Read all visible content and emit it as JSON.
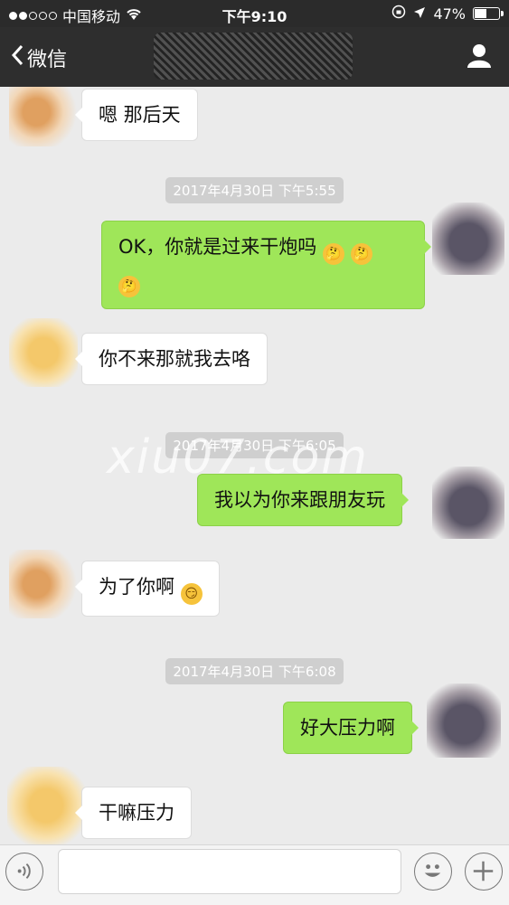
{
  "status_bar": {
    "carrier": "中国移动",
    "time": "下午9:10",
    "battery": "47%",
    "battery_level": 0.47
  },
  "nav": {
    "back_label": "微信"
  },
  "messages": [
    {
      "side": "left",
      "text": "嗯  那后天"
    },
    {
      "timestamp": "2017年4月30日 下午5:55"
    },
    {
      "side": "right",
      "text": "OK，你就是过来干炮吗"
    },
    {
      "side": "left",
      "text": "你不来那就我去咯"
    },
    {
      "timestamp": "2017年4月30日 下午6:05"
    },
    {
      "side": "right",
      "text": "我以为你来跟朋友玩"
    },
    {
      "side": "left",
      "text": "为了你啊"
    },
    {
      "timestamp": "2017年4月30日 下午6:08"
    },
    {
      "side": "right",
      "text": "好大压力啊"
    },
    {
      "side": "left",
      "text": "干嘛压力"
    }
  ],
  "watermark": "xiu07.com",
  "icons": [
    "voice-icon",
    "smile-icon",
    "plus-icon",
    "profile-icon",
    "back-chevron-icon"
  ]
}
